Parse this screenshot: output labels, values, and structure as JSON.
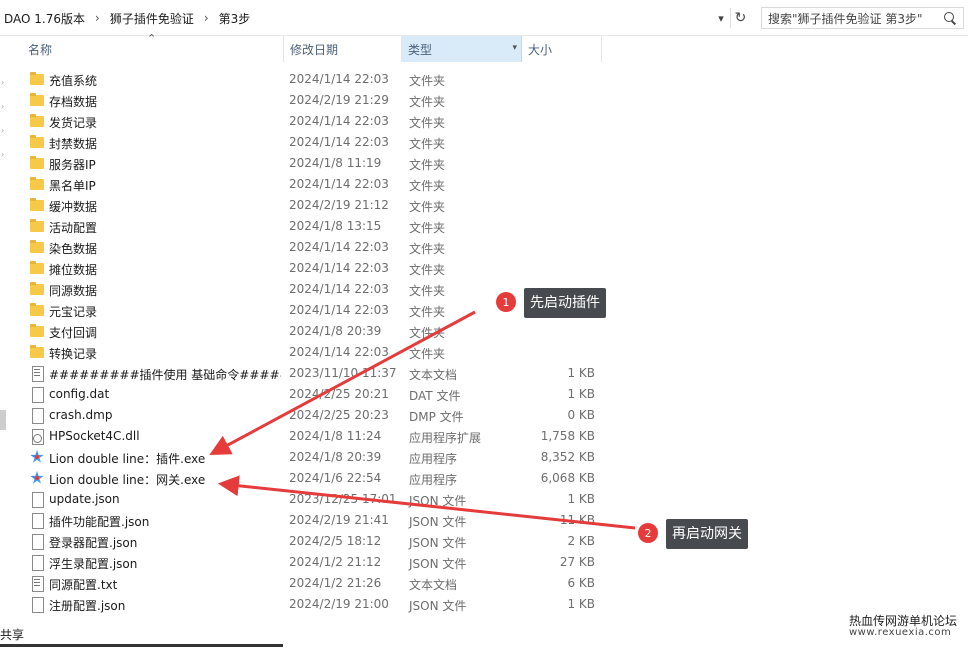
{
  "address": {
    "crumbs": [
      "DAO 1.76版本",
      "狮子插件免验证",
      "第3步"
    ],
    "separator": "›"
  },
  "search": {
    "placeholder": "搜索\"狮子插件免验证   第3步\""
  },
  "columns": {
    "name": "名称",
    "date": "修改日期",
    "type": "类型",
    "size": "大小"
  },
  "files": [
    {
      "name": "充值系统",
      "date": "2024/1/14 22:03",
      "type": "文件夹",
      "size": "",
      "icon": "folder-icon"
    },
    {
      "name": "存档数据",
      "date": "2024/2/19 21:29",
      "type": "文件夹",
      "size": "",
      "icon": "folder-icon"
    },
    {
      "name": "发货记录",
      "date": "2024/1/14 22:03",
      "type": "文件夹",
      "size": "",
      "icon": "folder-icon"
    },
    {
      "name": "封禁数据",
      "date": "2024/1/14 22:03",
      "type": "文件夹",
      "size": "",
      "icon": "folder-icon"
    },
    {
      "name": "服务器IP",
      "date": "2024/1/8 11:19",
      "type": "文件夹",
      "size": "",
      "icon": "folder-icon"
    },
    {
      "name": "黑名单IP",
      "date": "2024/1/14 22:03",
      "type": "文件夹",
      "size": "",
      "icon": "folder-icon"
    },
    {
      "name": "缓冲数据",
      "date": "2024/2/19 21:12",
      "type": "文件夹",
      "size": "",
      "icon": "folder-icon"
    },
    {
      "name": "活动配置",
      "date": "2024/1/8 13:15",
      "type": "文件夹",
      "size": "",
      "icon": "folder-icon"
    },
    {
      "name": "染色数据",
      "date": "2024/1/14 22:03",
      "type": "文件夹",
      "size": "",
      "icon": "folder-icon"
    },
    {
      "name": "摊位数据",
      "date": "2024/1/14 22:03",
      "type": "文件夹",
      "size": "",
      "icon": "folder-icon"
    },
    {
      "name": "同源数据",
      "date": "2024/1/14 22:03",
      "type": "文件夹",
      "size": "",
      "icon": "folder-icon"
    },
    {
      "name": "元宝记录",
      "date": "2024/1/14 22:03",
      "type": "文件夹",
      "size": "",
      "icon": "folder-icon"
    },
    {
      "name": "支付回调",
      "date": "2024/1/8 20:39",
      "type": "文件夹",
      "size": "",
      "icon": "folder-icon"
    },
    {
      "name": "转换记录",
      "date": "2024/1/14 22:03",
      "type": "文件夹",
      "size": "",
      "icon": "folder-icon"
    },
    {
      "name": "#########插件使用 基础命令#####...",
      "date": "2023/11/10 11:37",
      "type": "文本文档",
      "size": "1 KB",
      "icon": "text-file-icon"
    },
    {
      "name": "config.dat",
      "date": "2024/2/25 20:21",
      "type": "DAT 文件",
      "size": "1 KB",
      "icon": "file-icon"
    },
    {
      "name": "crash.dmp",
      "date": "2024/2/25 20:23",
      "type": "DMP 文件",
      "size": "0 KB",
      "icon": "file-icon"
    },
    {
      "name": "HPSocket4C.dll",
      "date": "2024/1/8 11:24",
      "type": "应用程序扩展",
      "size": "1,758 KB",
      "icon": "dll-icon"
    },
    {
      "name": "Lion double line：插件.exe",
      "date": "2024/1/8 20:39",
      "type": "应用程序",
      "size": "8,352 KB",
      "icon": "exe-icon"
    },
    {
      "name": "Lion double line：网关.exe",
      "date": "2024/1/6 22:54",
      "type": "应用程序",
      "size": "6,068 KB",
      "icon": "exe-icon"
    },
    {
      "name": "update.json",
      "date": "2023/12/25 17:01",
      "type": "JSON 文件",
      "size": "1 KB",
      "icon": "file-icon"
    },
    {
      "name": "插件功能配置.json",
      "date": "2024/2/19 21:41",
      "type": "JSON 文件",
      "size": "11 KB",
      "icon": "file-icon"
    },
    {
      "name": "登录器配置.json",
      "date": "2024/2/5 18:12",
      "type": "JSON 文件",
      "size": "2 KB",
      "icon": "file-icon"
    },
    {
      "name": "浮生录配置.json",
      "date": "2024/1/2 21:12",
      "type": "JSON 文件",
      "size": "27 KB",
      "icon": "file-icon"
    },
    {
      "name": "同源配置.txt",
      "date": "2024/1/2 21:26",
      "type": "文本文档",
      "size": "6 KB",
      "icon": "text-file-icon"
    },
    {
      "name": "注册配置.json",
      "date": "2024/2/19 21:00",
      "type": "JSON 文件",
      "size": "1 KB",
      "icon": "file-icon"
    }
  ],
  "annotations": [
    {
      "number": "1",
      "text": "先启动插件"
    },
    {
      "number": "2",
      "text": "再启动网关"
    }
  ],
  "annotation_color": "#e63b3b",
  "status": {
    "share": "共享"
  },
  "watermark": {
    "title": "热血传网游单机论坛",
    "url": "www.rexuexia.com"
  }
}
